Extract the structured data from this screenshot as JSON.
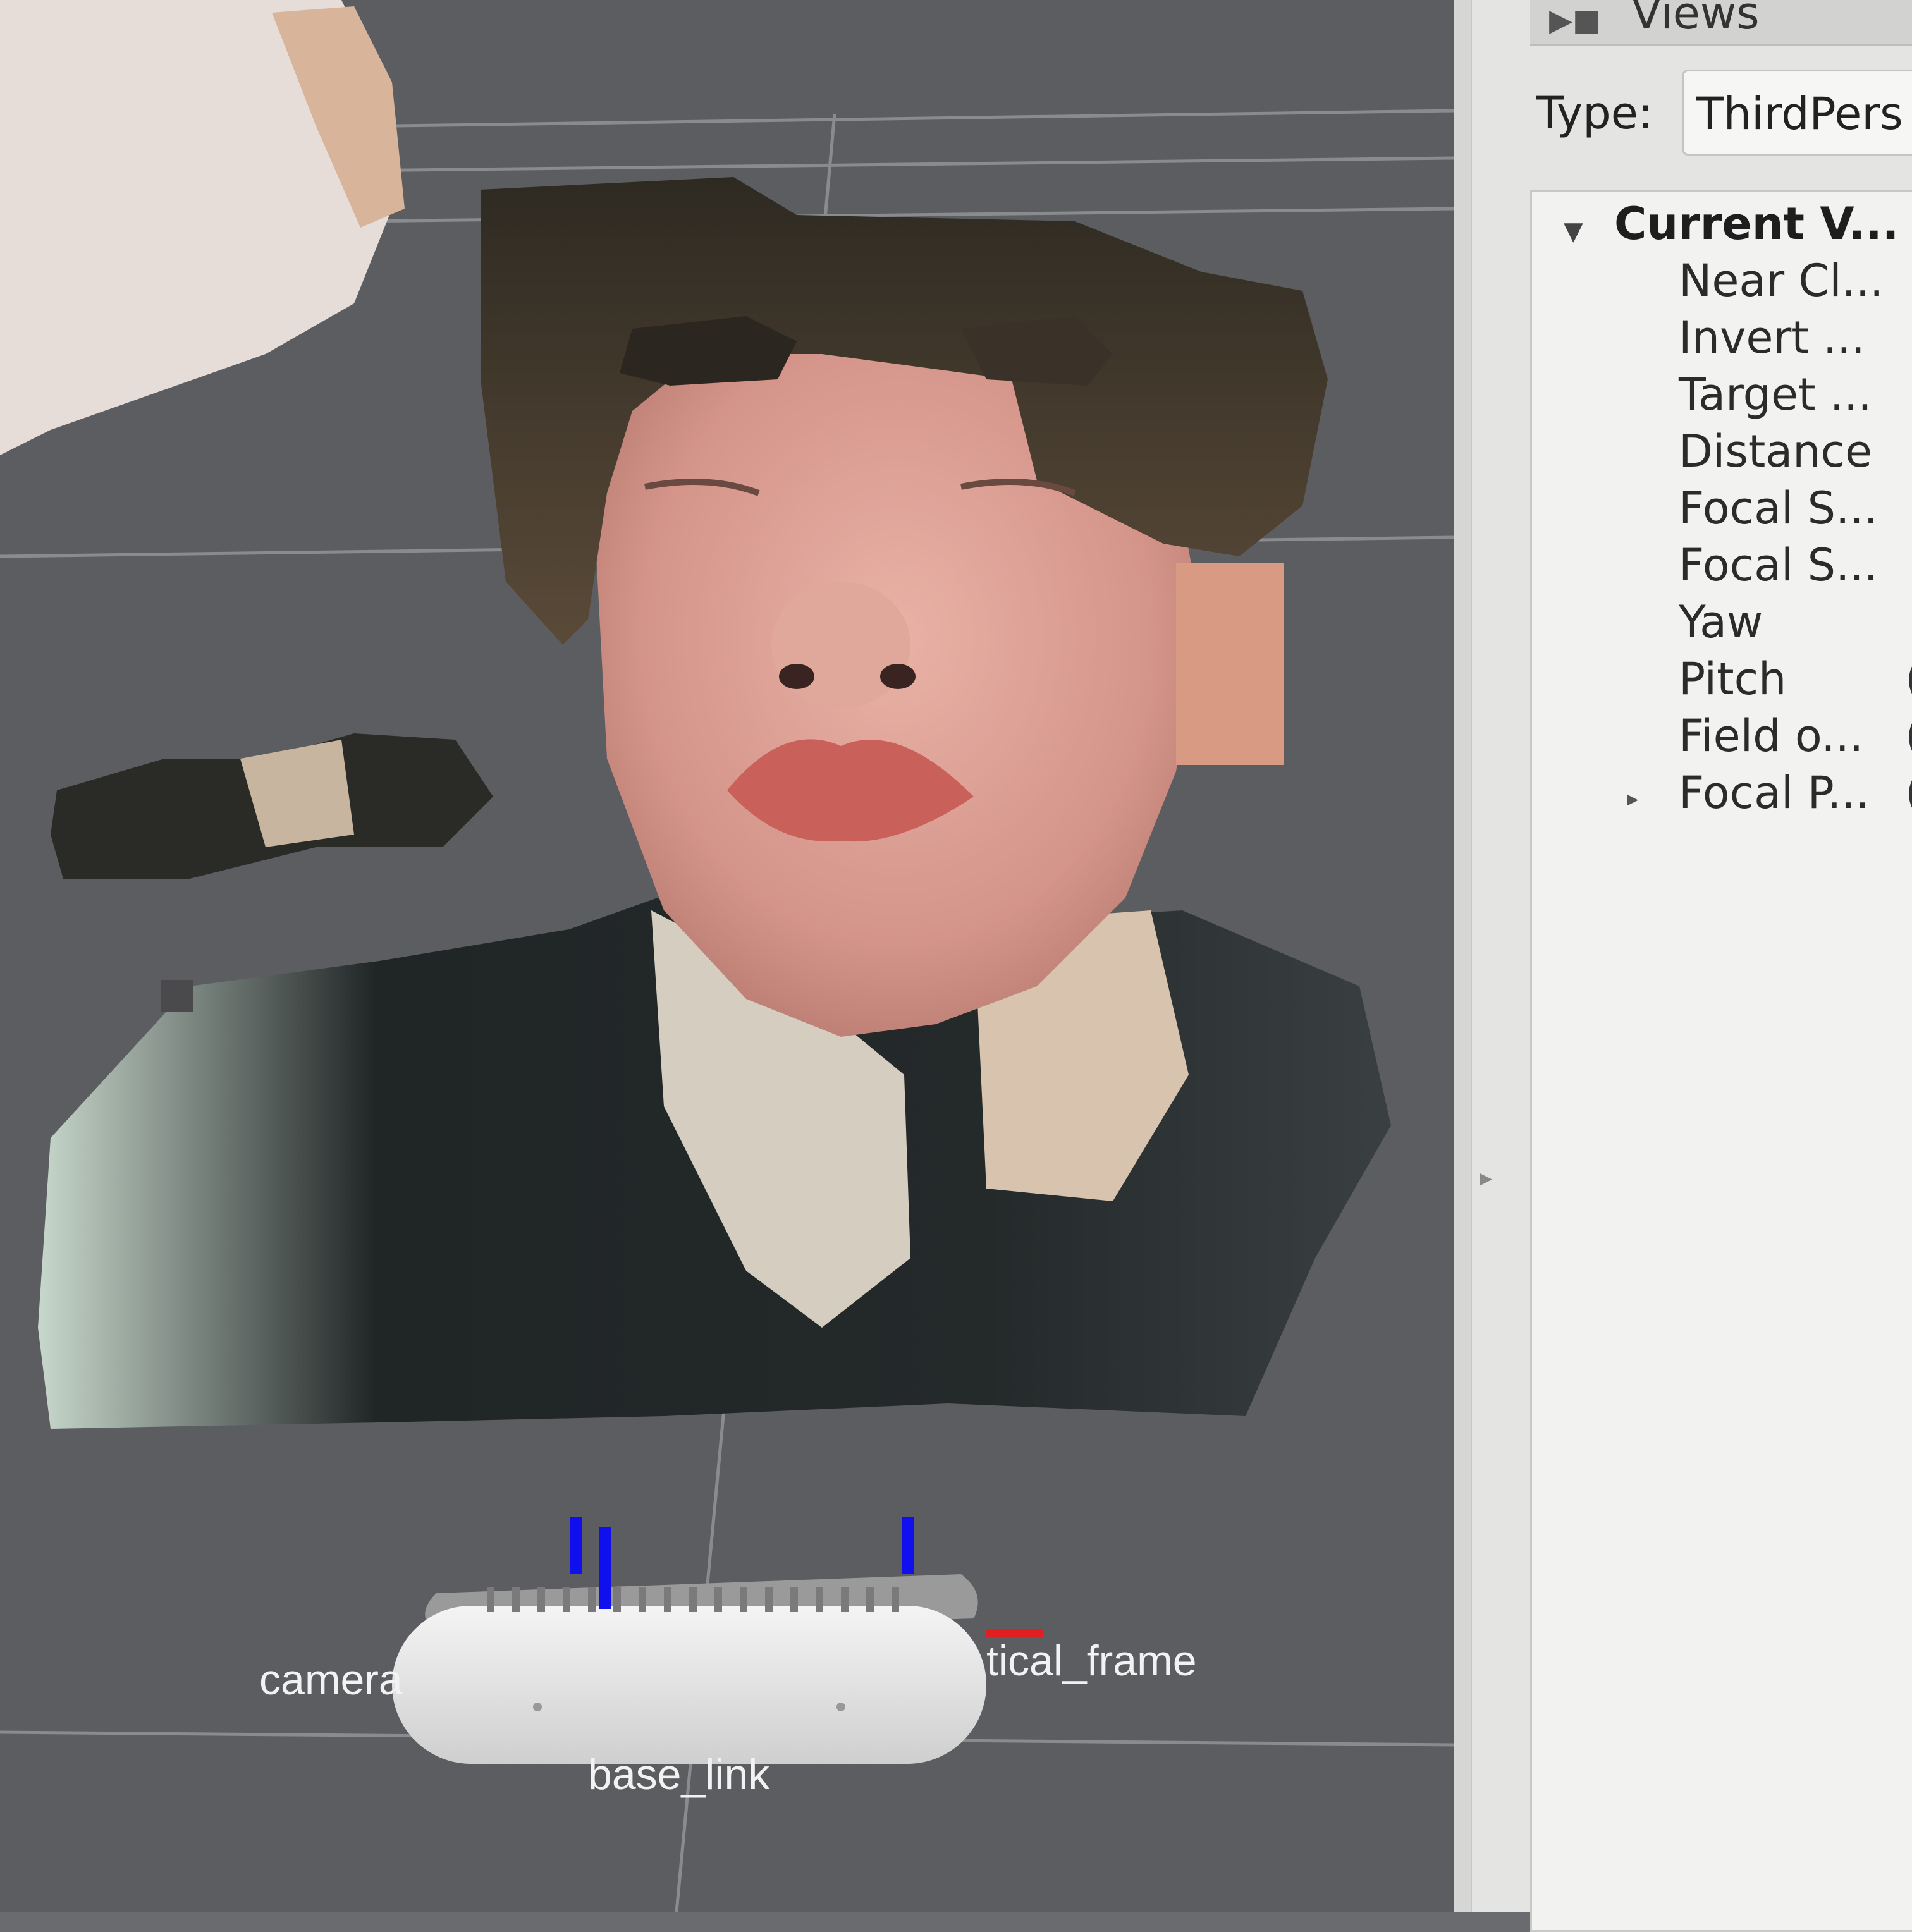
{
  "viewport": {
    "frame_labels": {
      "camera_left": "camera",
      "right_frame": "tical_frame",
      "base_link": "base_link"
    }
  },
  "views_panel": {
    "title": "Views",
    "type_label": "Type:",
    "type_value": "ThirdPers",
    "tree": {
      "root": "Current V...",
      "items": [
        {
          "label": "Near Cl...",
          "value": ""
        },
        {
          "label": "Invert ...",
          "value": ""
        },
        {
          "label": "Target ...",
          "value": ""
        },
        {
          "label": "Distance",
          "value": ""
        },
        {
          "label": "Focal S...",
          "value": ""
        },
        {
          "label": "Focal S...",
          "value": ""
        },
        {
          "label": "Yaw",
          "value": ""
        },
        {
          "label": "Pitch",
          "value": "("
        },
        {
          "label": "Field o...",
          "value": "("
        },
        {
          "label": "Focal P...",
          "value": "("
        }
      ]
    }
  },
  "colors": {
    "background": "#5c5d60",
    "panel": "#e4e4e2",
    "axis_z": "#1010ee",
    "axis_x": "#e02020"
  }
}
